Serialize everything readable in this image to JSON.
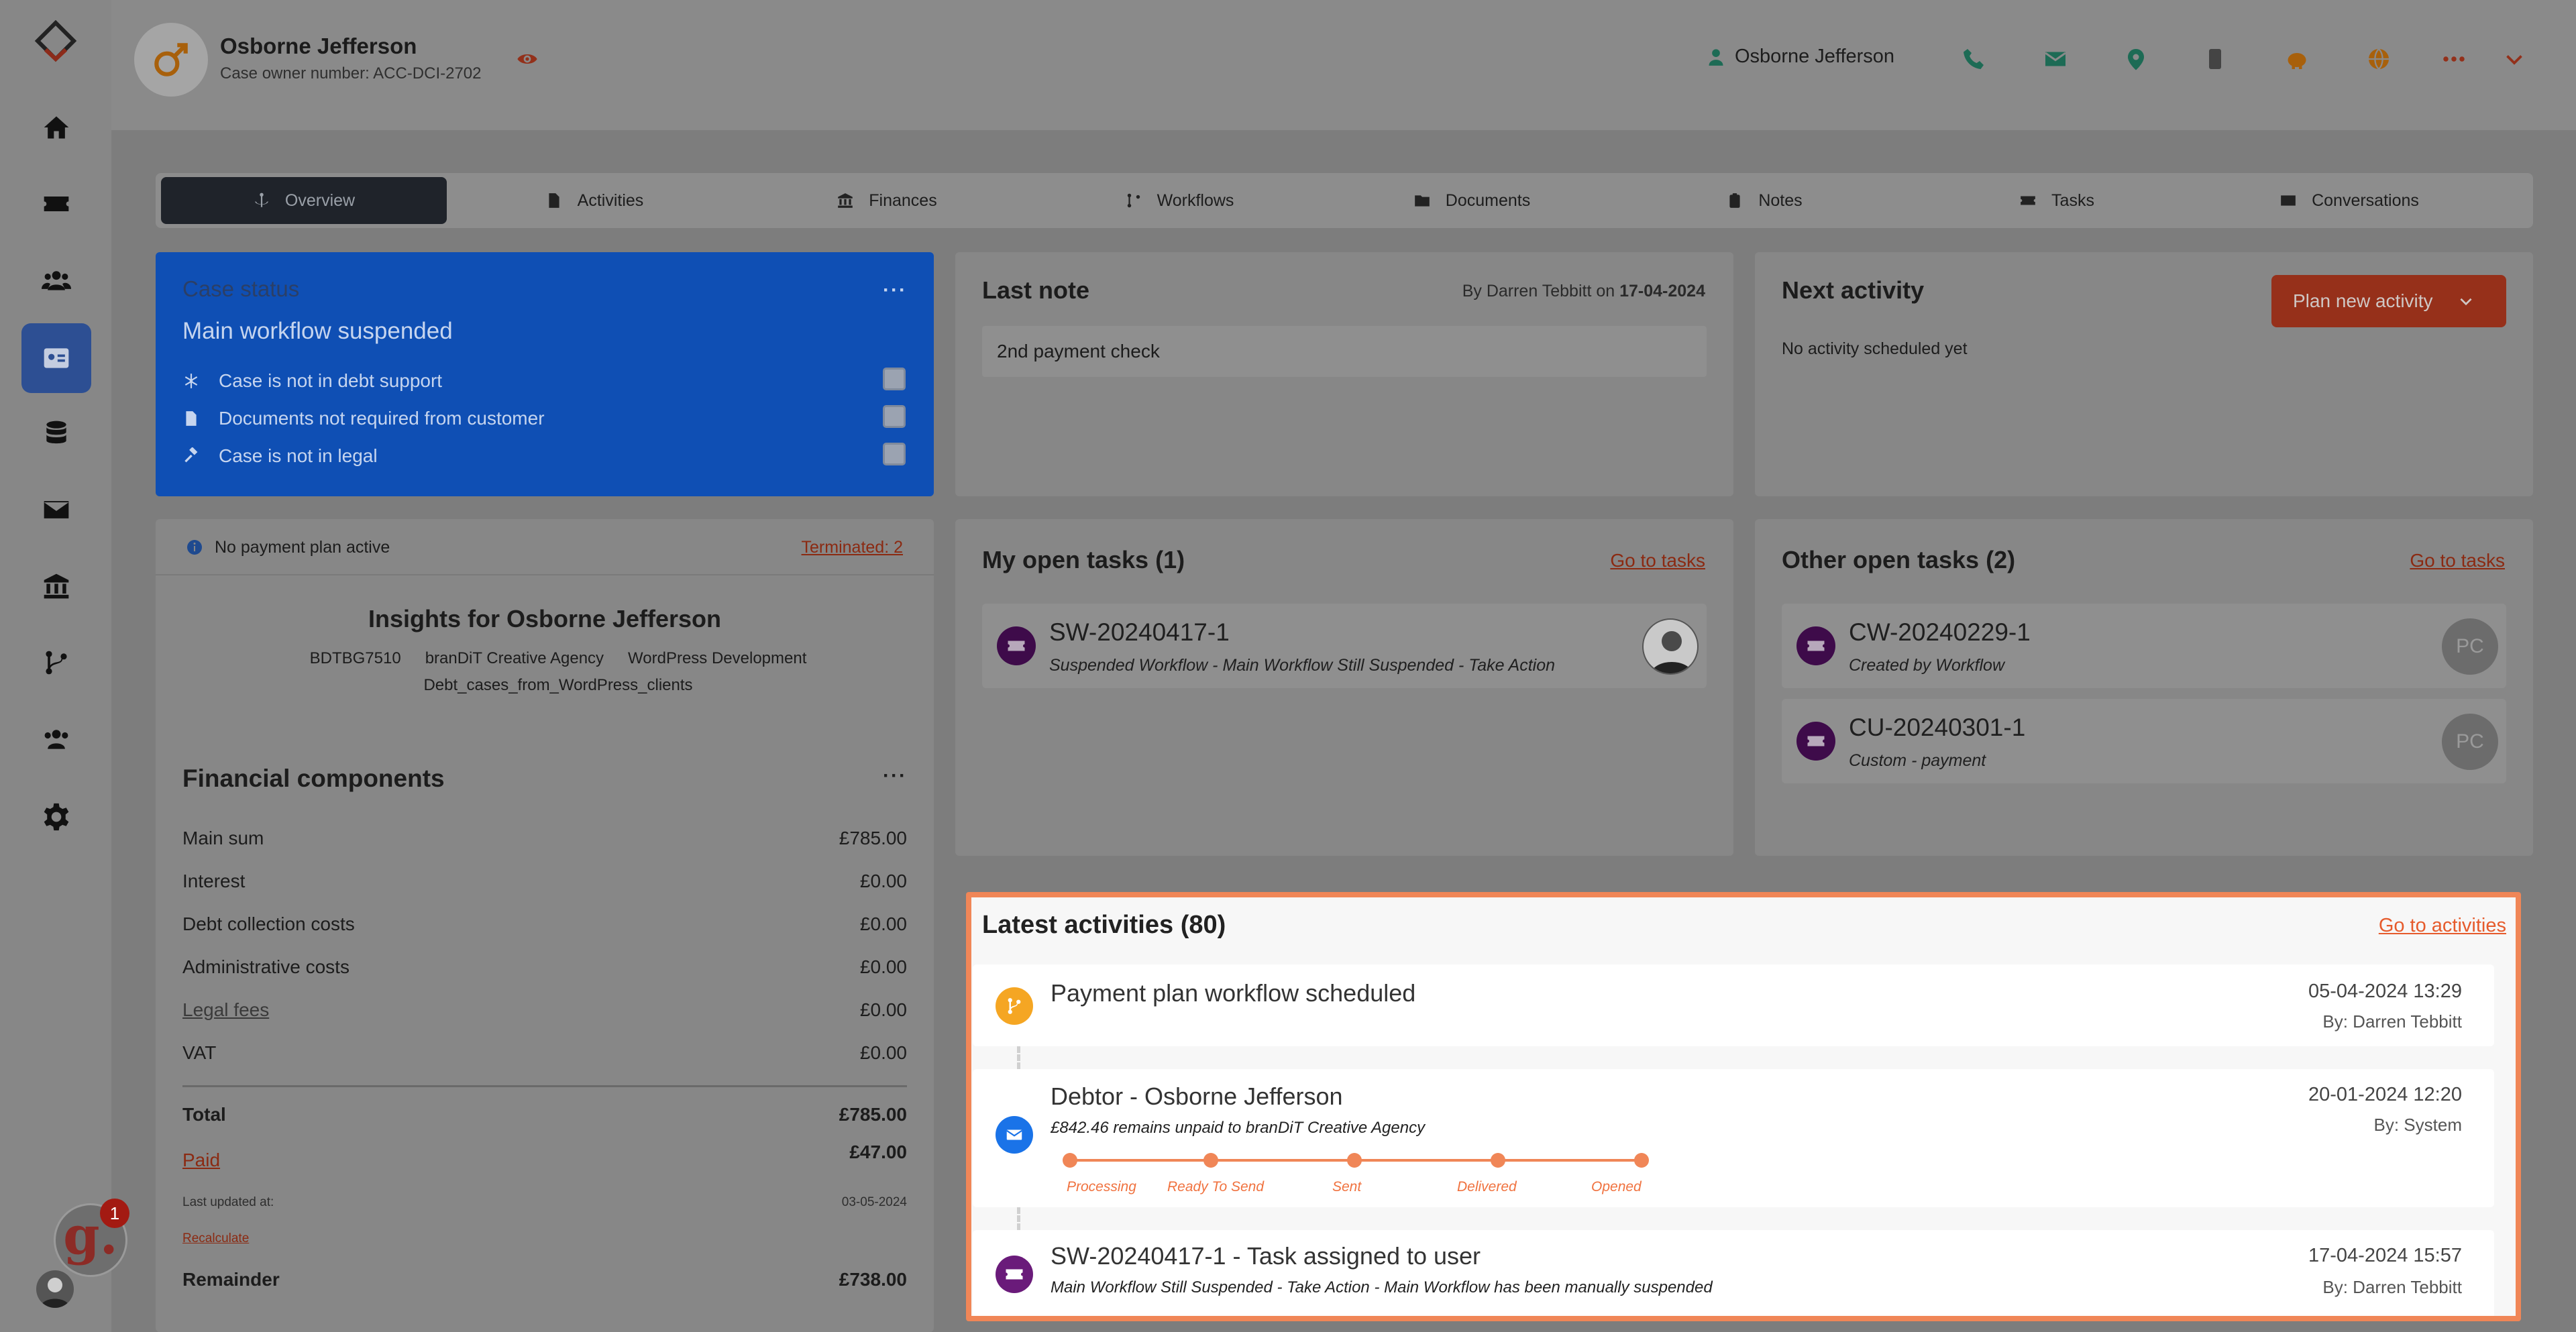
{
  "header": {
    "owner_name": "Osborne Jefferson",
    "owner_number": "Case owner number: ACC-DCI-2702",
    "user_name": "Osborne Jefferson"
  },
  "tabs": [
    {
      "label": "Overview",
      "icon": "anchor-icon"
    },
    {
      "label": "Activities",
      "icon": "file-icon"
    },
    {
      "label": "Finances",
      "icon": "bank-icon"
    },
    {
      "label": "Workflows",
      "icon": "branch-icon"
    },
    {
      "label": "Documents",
      "icon": "folder-icon"
    },
    {
      "label": "Notes",
      "icon": "clipboard-icon"
    },
    {
      "label": "Tasks",
      "icon": "ticket-icon"
    },
    {
      "label": "Conversations",
      "icon": "envelope-icon"
    }
  ],
  "case_status": {
    "title": "Case status",
    "subtitle": "Main workflow suspended",
    "items": [
      {
        "label": "Case is not in debt support",
        "icon": "asterisk-icon"
      },
      {
        "label": "Documents not required from customer",
        "icon": "file-icon"
      },
      {
        "label": "Case is not in legal",
        "icon": "gavel-icon"
      }
    ]
  },
  "last_note": {
    "title": "Last note",
    "by": "By Darren Tebbitt on",
    "date": "17-04-2024",
    "text": "2nd payment check"
  },
  "next_activity": {
    "title": "Next activity",
    "button": "Plan new activity",
    "empty": "No activity scheduled yet"
  },
  "payment_plan": {
    "status": "No payment plan active",
    "terminated": "Terminated: 2"
  },
  "insights": {
    "title": "Insights for Osborne Jefferson",
    "tags": [
      "BDTBG7510",
      "branDiT Creative Agency",
      "WordPress Development",
      "Debt_cases_from_WordPress_clients"
    ]
  },
  "financial": {
    "title": "Financial components",
    "rows": [
      {
        "label": "Main sum",
        "value": "£785.00"
      },
      {
        "label": "Interest",
        "value": "£0.00"
      },
      {
        "label": "Debt collection costs",
        "value": "£0.00"
      },
      {
        "label": "Administrative costs",
        "value": "£0.00"
      },
      {
        "label": "Legal fees",
        "value": "£0.00"
      },
      {
        "label": "VAT",
        "value": "£0.00"
      }
    ],
    "total_label": "Total",
    "total_value": "£785.00",
    "paid_label": "Paid",
    "paid_value": "£47.00",
    "last_updated_label": "Last updated at:",
    "last_updated_value": "03-05-2024",
    "recalculate": "Recalculate",
    "remainder_label": "Remainder",
    "remainder_value": "£738.00"
  },
  "my_tasks": {
    "title": "My open tasks (1)",
    "link": "Go to tasks",
    "items": [
      {
        "id": "SW-20240417-1",
        "desc": "Suspended Workflow - Main Workflow Still Suspended - Take Action"
      }
    ]
  },
  "other_tasks": {
    "title": "Other open tasks (2)",
    "link": "Go to tasks",
    "items": [
      {
        "id": "CW-20240229-1",
        "desc": "Created by Workflow",
        "initials": "PC"
      },
      {
        "id": "CU-20240301-1",
        "desc": "Custom - payment",
        "initials": "PC"
      }
    ]
  },
  "activities": {
    "title": "Latest activities (80)",
    "link": "Go to activities",
    "items": [
      {
        "name": "Payment plan workflow scheduled",
        "date": "05-04-2024 13:29",
        "by": "By: Darren Tebbitt",
        "color": "#f5a623"
      },
      {
        "name": "Debtor - Osborne Jefferson",
        "desc": "£842.46 remains unpaid to branDiT Creative Agency",
        "date": "20-01-2024 12:20",
        "by": "By: System",
        "color": "#1a73e8",
        "steps": [
          "Processing",
          "Ready To Send",
          "Sent",
          "Delivered",
          "Opened"
        ]
      },
      {
        "name": "SW-20240417-1 - Task assigned to user",
        "desc": "Main Workflow Still Suspended - Take Action - Main Workflow has been manually suspended",
        "date": "17-04-2024 15:57",
        "by": "By: Darren Tebbitt",
        "color": "#6a1b7a"
      }
    ]
  },
  "notification_count": "1",
  "colors": {
    "accent": "#f08657",
    "case_blue": "#0f4fb4",
    "dark_tab": "#1f232a"
  }
}
